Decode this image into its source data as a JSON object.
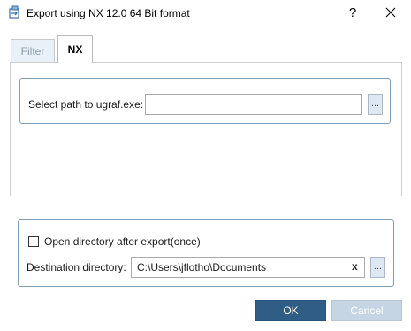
{
  "window": {
    "title": "Export using NX 12.0 64 Bit format",
    "help_label": "?"
  },
  "tabs": [
    {
      "label": "Filter",
      "active": false
    },
    {
      "label": "NX",
      "active": true
    }
  ],
  "nx_panel": {
    "path_label": "Select path to ugraf.exe:",
    "path_value": "",
    "browse_label": "..."
  },
  "destination": {
    "open_dir_label": "Open directory after export(once)",
    "open_dir_checked": false,
    "dest_label": "Destination directory:",
    "dest_value": "C:\\Users\\jflotho\\Documents",
    "clear_label": "x",
    "browse_label": "..."
  },
  "buttons": {
    "ok": "OK",
    "cancel": "Cancel"
  },
  "colors": {
    "ok_bg": "#2f5d86",
    "cancel_bg": "#c6d5e3",
    "group_border": "#7f9db9"
  }
}
